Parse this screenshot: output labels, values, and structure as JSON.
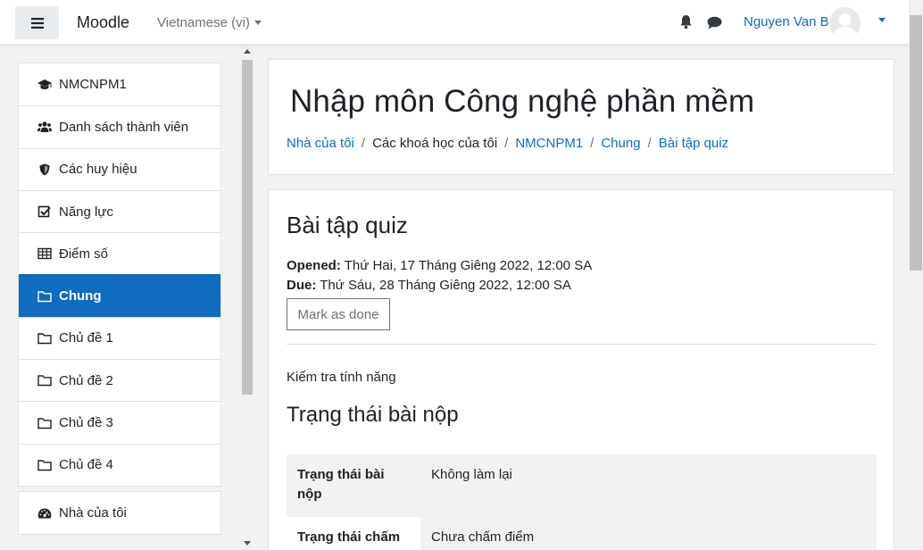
{
  "navbar": {
    "brand": "Moodle",
    "language": "Vietnamese (vi)",
    "username": "Nguyen Van B"
  },
  "sidebar": {
    "groups": [
      {
        "items": [
          {
            "label": "NMCNPM1",
            "icon": "graduation-cap-icon",
            "active": false
          },
          {
            "label": "Danh sách thành viên",
            "icon": "users-icon",
            "active": false
          },
          {
            "label": "Các huy hiệu",
            "icon": "shield-icon",
            "active": false
          },
          {
            "label": "Năng lực",
            "icon": "check-square-icon",
            "active": false
          },
          {
            "label": "Điểm số",
            "icon": "table-icon",
            "active": false
          },
          {
            "label": "Chung",
            "icon": "folder-icon",
            "active": true
          },
          {
            "label": "Chủ đề 1",
            "icon": "folder-icon",
            "active": false
          },
          {
            "label": "Chủ đề 2",
            "icon": "folder-icon",
            "active": false
          },
          {
            "label": "Chủ đề 3",
            "icon": "folder-icon",
            "active": false
          },
          {
            "label": "Chủ đề 4",
            "icon": "folder-icon",
            "active": false
          }
        ]
      },
      {
        "items": [
          {
            "label": "Nhà của tôi",
            "icon": "dashboard-icon",
            "active": false
          }
        ]
      }
    ]
  },
  "header": {
    "title": "Nhập môn Công nghệ phần mềm",
    "breadcrumb": [
      {
        "label": "Nhà của tôi",
        "link": true
      },
      {
        "label": "Các khoá học của tôi",
        "link": false
      },
      {
        "label": "NMCNPM1",
        "link": true
      },
      {
        "label": "Chung",
        "link": true
      },
      {
        "label": "Bài tập quiz",
        "link": true
      }
    ]
  },
  "activity": {
    "title": "Bài tập quiz",
    "opened_label": "Opened:",
    "opened_value": "Thứ Hai, 17 Tháng Giêng 2022, 12:00 SA",
    "due_label": "Due:",
    "due_value": "Thứ Sáu, 28 Tháng Giêng 2022, 12:00 SA",
    "mark_done": "Mark as done",
    "intro": "Kiểm tra tính năng",
    "status_heading": "Trạng thái bài nộp",
    "status_rows": [
      {
        "label": "Trạng thái bài nộp",
        "value": "Không làm lại"
      },
      {
        "label": "Trạng thái chấm",
        "value": "Chưa chấm điểm"
      }
    ]
  },
  "colors": {
    "accent": "#0f6cbf",
    "active_bg": "#0f6cbf",
    "text": "#1d2125",
    "muted": "#6a737b"
  }
}
